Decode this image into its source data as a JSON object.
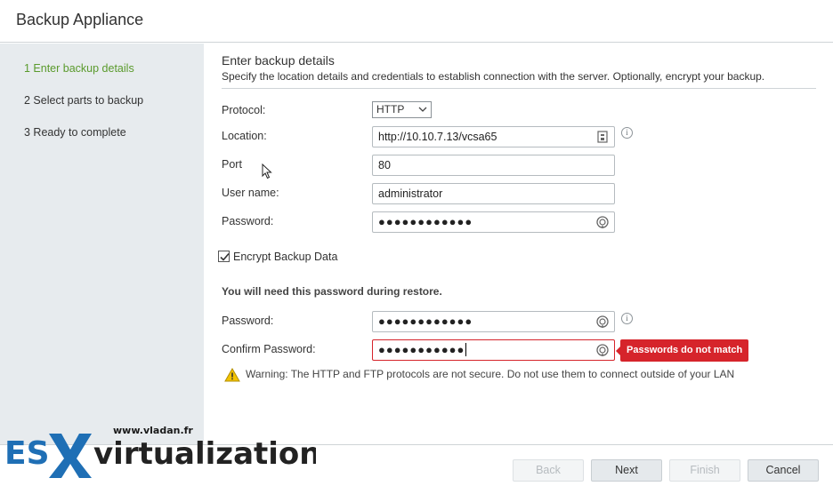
{
  "window": {
    "title": "Backup Appliance"
  },
  "steps": [
    {
      "label": "1 Enter backup details",
      "active": true
    },
    {
      "label": "2 Select parts to backup",
      "active": false
    },
    {
      "label": "3 Ready to complete",
      "active": false
    }
  ],
  "section": {
    "title": "Enter backup details",
    "description": "Specify the location details and credentials to establish connection with the server. Optionally, encrypt your backup."
  },
  "form": {
    "protocol_label": "Protocol:",
    "protocol_value": "HTTP",
    "location_label": "Location:",
    "location_value": "http://10.10.7.13/vcsa65",
    "port_label": "Port",
    "port_value": "80",
    "username_label": "User name:",
    "username_value": "administrator",
    "password_label": "Password:",
    "password_value": "●●●●●●●●●●●●"
  },
  "encrypt": {
    "label": "Encrypt Backup Data",
    "checked": true,
    "note": "You will need this password during restore.",
    "password_label": "Password:",
    "password_value": "●●●●●●●●●●●●",
    "confirm_label": "Confirm Password:",
    "confirm_value": "●●●●●●●●●●●",
    "error_text": "Passwords do not match"
  },
  "warning_text": "Warning: The HTTP and FTP protocols are not secure. Do not use them to connect outside of your LAN",
  "buttons": {
    "back": "Back",
    "next": "Next",
    "finish": "Finish",
    "cancel": "Cancel"
  },
  "watermark": {
    "url": "www.vladan.fr",
    "brand_left": "ES",
    "brand_right": "virtualization"
  },
  "colors": {
    "active_step": "#5a9a2c",
    "error": "#d6242b",
    "sidebar_bg": "#e7ebee"
  }
}
